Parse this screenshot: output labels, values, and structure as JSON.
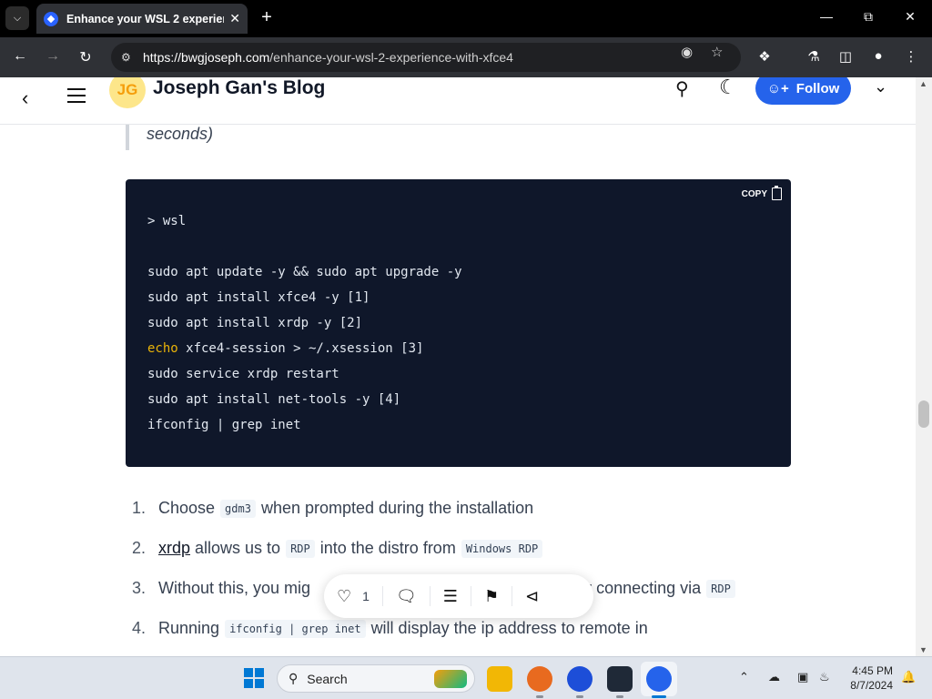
{
  "browser": {
    "tab_title": "Enhance your WSL 2 experienc",
    "url_host": "https://bwgjoseph.com",
    "url_path": "/enhance-your-wsl-2-experience-with-xfce4",
    "icons": [
      "tab-menu-icon",
      "close-icon",
      "plus-icon",
      "minimize-icon",
      "restore-icon",
      "back-icon",
      "forward-icon",
      "reload-icon",
      "eye-off-icon",
      "star-icon",
      "extensions-icon",
      "labs-icon",
      "sidebar-icon",
      "profile-icon",
      "kebab-icon"
    ]
  },
  "blog": {
    "logo_initials": "JG",
    "title": "Joseph Gan's Blog",
    "follow_label": "Follow",
    "accent_color": "#2563eb"
  },
  "article": {
    "quote_tail": "seconds)",
    "code": {
      "copy_label": "COPY",
      "lines": [
        {
          "pre": "> wsl",
          "kw": "",
          "rest": ""
        },
        {
          "pre": "",
          "kw": "",
          "rest": ""
        },
        {
          "pre": "sudo apt update -y && sudo apt upgrade -y",
          "kw": "",
          "rest": ""
        },
        {
          "pre": "sudo apt install xfce4 -y [1]",
          "kw": "",
          "rest": ""
        },
        {
          "pre": "sudo apt install xrdp -y [2]",
          "kw": "",
          "rest": ""
        },
        {
          "pre": "",
          "kw": "echo",
          "rest": " xfce4-session > ~/.xsession [3]"
        },
        {
          "pre": "sudo service xrdp restart",
          "kw": "",
          "rest": ""
        },
        {
          "pre": "sudo apt install net-tools -y [4]",
          "kw": "",
          "rest": ""
        },
        {
          "pre": "ifconfig | grep inet",
          "kw": "",
          "rest": ""
        }
      ]
    },
    "list": [
      {
        "num": "1.",
        "a": "Choose",
        "code1": "gdm3",
        "b": "when prompted during the installation"
      },
      {
        "num": "2.",
        "link": "xrdp",
        "a": "allows us to",
        "code1": "RDP",
        "b": "into the distro from",
        "code2": "Windows RDP"
      },
      {
        "num": "3.",
        "a": "Without this, you mig",
        "b": "fter connecting via",
        "code2": "RDP"
      },
      {
        "num": "4.",
        "a": "Running",
        "code1": "ifconfig | grep inet",
        "b": "will display the ip address to remote in"
      }
    ]
  },
  "reaction_bar": {
    "like_count": "1"
  },
  "taskbar": {
    "search_label": "Search",
    "time": "4:45 PM",
    "date": "8/7/2024"
  }
}
